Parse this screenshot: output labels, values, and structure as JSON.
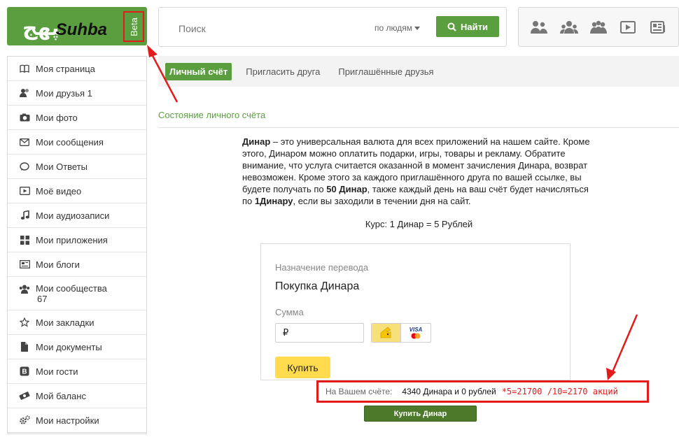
{
  "logo": {
    "script_text": "ﭙﻬﺞ",
    "latin_text": "Suhba",
    "badge": "Beta"
  },
  "search": {
    "placeholder": "Поиск",
    "filter": "по людям",
    "button": "Найти"
  },
  "top_icons": [
    "people-icon",
    "friends-icon",
    "communities-icon",
    "video-icon",
    "news-icon"
  ],
  "sidebar": {
    "items": [
      {
        "label": "Моя страница",
        "icon": "book-icon"
      },
      {
        "label": "Мои друзья 1",
        "icon": "friends-icon"
      },
      {
        "label": "Мои фото",
        "icon": "camera-icon"
      },
      {
        "label": "Мои сообщения",
        "icon": "envelope-icon"
      },
      {
        "label": "Мои Ответы",
        "icon": "speech-bubble-icon"
      },
      {
        "label": "Моё видео",
        "icon": "video-icon"
      },
      {
        "label": "Мои аудиозаписи",
        "icon": "music-note-icon"
      },
      {
        "label": "Мои приложения",
        "icon": "apps-grid-icon"
      },
      {
        "label": "Мои блоги",
        "icon": "blog-icon"
      },
      {
        "label": "Мои сообщества",
        "count": "67",
        "icon": "community-icon"
      },
      {
        "label": "Мои закладки",
        "icon": "star-icon"
      },
      {
        "label": "Мои документы",
        "icon": "document-icon"
      },
      {
        "label": "Мои гости",
        "icon": "guests-icon"
      },
      {
        "label": "Мой баланс",
        "icon": "money-icon"
      },
      {
        "label": "Мои настройки",
        "icon": "settings-icon"
      }
    ]
  },
  "tabs": [
    {
      "label": "Личный счёт",
      "active": true
    },
    {
      "label": "Пригласить друга",
      "active": false
    },
    {
      "label": "Приглашённые друзья",
      "active": false
    }
  ],
  "section_title": "Состояние личного счёта",
  "info": {
    "term": "Динар",
    "text1": " – это универсальная валюта для всех приложений на нашем сайте. Кроме этого, Динаром можно оплатить подарки, игры, товары и рекламу. Обратите внимание, что услуга считается оказанной в момент зачисления Динара, возврат невозможен. Кроме этого за каждого приглашённого друга по вашей ссылке, вы будете получать по ",
    "bonus": "50 Динар",
    "text2": ", также каждый день на ваш счёт будет начисляться по ",
    "daily": "1Динару",
    "text3": ", если вы заходили в течении дня на сайт."
  },
  "rate": "Курс: 1 Динар = 5 Рублей",
  "payment": {
    "purpose_label": "Назначение перевода",
    "purpose_value": "Покупка Динара",
    "sum_label": "Сумма",
    "sum_value": "₽",
    "method_visa": "VISA",
    "buy_label": "Купить"
  },
  "balance": {
    "label": "На Вашем счёте:",
    "value": "4340 Динара и 0 рублей",
    "annotation": "*5=21700 /10=2170 акций"
  },
  "buy_dinar_label": "Купить Динар",
  "colors": {
    "brand_green": "#5a9e3f",
    "annotation_red": "#e31b1b",
    "pay_yellow": "#ffdb4d"
  }
}
